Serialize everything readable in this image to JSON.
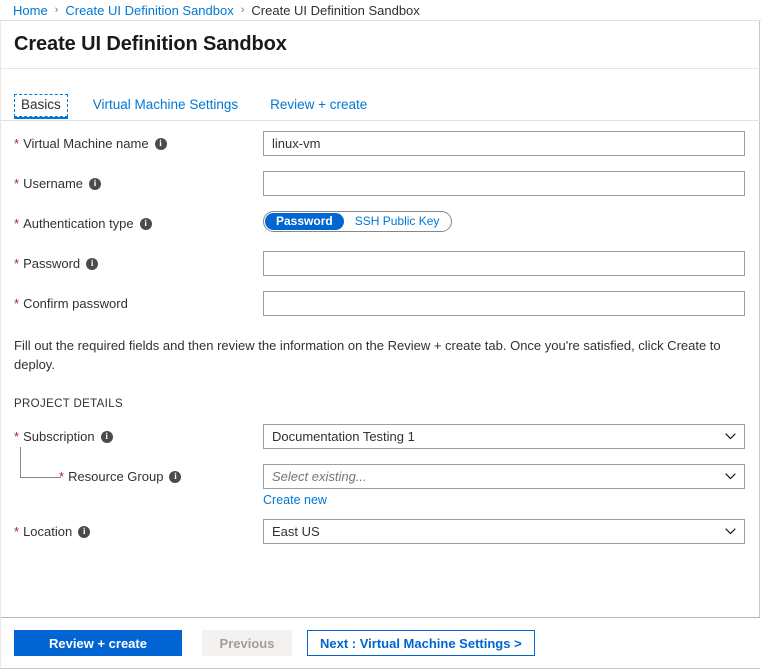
{
  "breadcrumb": {
    "items": [
      {
        "label": "Home",
        "link": true
      },
      {
        "label": "Create UI Definition Sandbox",
        "link": true
      },
      {
        "label": "Create UI Definition Sandbox",
        "link": false
      }
    ],
    "separator": "›"
  },
  "header": {
    "title": "Create UI Definition Sandbox"
  },
  "tabs": [
    {
      "label": "Basics",
      "active": true
    },
    {
      "label": "Virtual Machine Settings",
      "active": false
    },
    {
      "label": "Review + create",
      "active": false
    }
  ],
  "form": {
    "required_marker": "*",
    "info_glyph": "i",
    "vm_name": {
      "label": "Virtual Machine name",
      "value": "linux-vm",
      "placeholder": ""
    },
    "username": {
      "label": "Username",
      "value": "",
      "placeholder": ""
    },
    "auth_type": {
      "label": "Authentication type",
      "options": [
        "Password",
        "SSH Public Key"
      ],
      "selected": "Password"
    },
    "password": {
      "label": "Password",
      "value": "",
      "placeholder": ""
    },
    "confirm_password": {
      "label": "Confirm password",
      "value": "",
      "placeholder": ""
    },
    "instructions": "Fill out the required fields and then review the information on the Review + create tab. Once you're satisfied, click Create to deploy.",
    "section_title": "PROJECT DETAILS",
    "subscription": {
      "label": "Subscription",
      "selected": "Documentation Testing 1"
    },
    "resource_group": {
      "label": "Resource Group",
      "selected": "Select existing...",
      "create_new_link": "Create new"
    },
    "location": {
      "label": "Location",
      "selected": "East US"
    }
  },
  "footer": {
    "review_create": "Review + create",
    "previous": "Previous",
    "next": "Next : Virtual Machine Settings >"
  },
  "colors": {
    "accent": "#0078d4",
    "primary_button": "#0065d3",
    "required_red": "#a4262c",
    "toggle_on": "#0067d2"
  }
}
